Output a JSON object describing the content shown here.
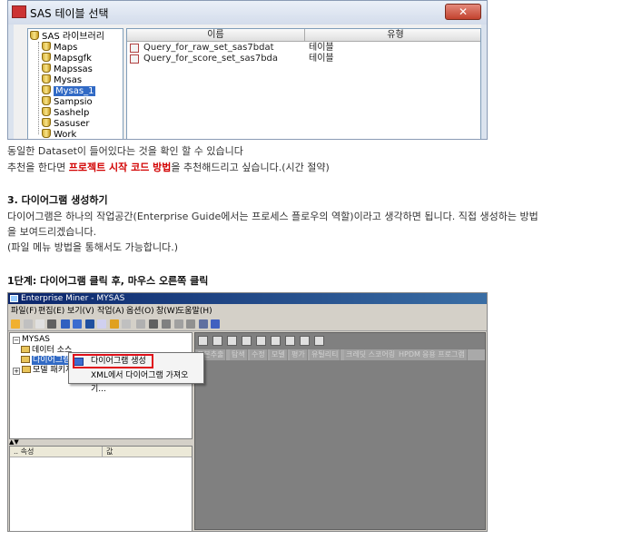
{
  "shot1": {
    "title": "SAS 테이블 선택",
    "libraries": {
      "root": "SAS 라이브러리",
      "items": [
        "Maps",
        "Mapsgfk",
        "Mapssas",
        "Mysas",
        "Mysas_1",
        "Sampsio",
        "Sashelp",
        "Sasuser",
        "Work"
      ],
      "selected": "Mysas_1"
    },
    "columns": {
      "name": "이름",
      "type": "유형"
    },
    "rows": [
      {
        "name": "Query_for_raw_set_sas7bdat",
        "type": "테이블"
      },
      {
        "name": "Query_for_score_set_sas7bda",
        "type": "테이블"
      }
    ]
  },
  "text": {
    "line1": "동일한 Dataset이 들어있다는 것을 확인 할 수 있습니다",
    "line2_pre": "추천을 한다면 ",
    "line2_red": "프로젝트 시작 코드 방법",
    "line2_post": "을 추천해드리고 싶습니다.(시간 절약)",
    "section_heading": "3. 다이어그램 생성하기",
    "para1": " 다이어그램은 하나의 작업공간(Enterprise Guide에서는 프로세스 플로우의 역할)이라고 생각하면 됩니다. 직접 생성하는 방법",
    "para1_cont": "을 보여드리겠습니다.",
    "para2": "(파일 메뉴 방법을 통해서도 가능합니다.)",
    "step1": "1단계: 다이어그램 클릭 후, 마우스 오른쪽 클릭"
  },
  "shot2": {
    "title": "Enterprise Miner - MYSAS",
    "menu": [
      "파일(F)",
      "편집(E)",
      "보기(V)",
      "작업(A)",
      "옵션(O)",
      "창(W)",
      "도움말(H)"
    ],
    "tree": {
      "root": "MYSAS",
      "items": [
        "데이터 소스",
        "다이어그램",
        "모델 패키지"
      ],
      "selected": "다이어그램"
    },
    "context_menu": [
      "다이어그램 생성",
      "XML에서 다이어그램 가져오기..."
    ],
    "splitter_arrows": "▲▼",
    "properties": {
      "col_property": ".. 속성",
      "col_value": "값"
    },
    "tabs": [
      "표본추출",
      "탐색",
      "수정",
      "모델",
      "평가",
      "유틸리티",
      "크레딧 스코어링",
      "HPDM",
      "응용 프로그램"
    ]
  }
}
